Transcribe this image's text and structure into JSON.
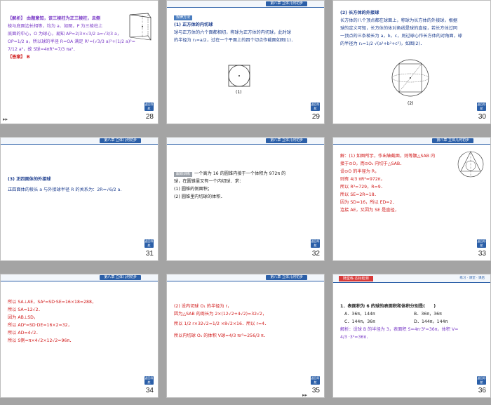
{
  "header_tab": "第八章 立体几何初步",
  "back_label": "返回导航",
  "slides": [
    {
      "page": "28",
      "lines": [
        "【解析】 由题意知，该三棱柱为正三棱柱，且侧",
        "棱与底面边长相等，均为 a．如图，P 为三棱柱上",
        "底面的中心，O 为球心，易知 AP=2/3×√3/2 a=√3/3 a，",
        "OP=1/2 a，所以球的半径 R=OA 满足 R²=(√3/3 a)²+(1/2 a)²=",
        "7/12 a²，故 S球=4πR²=7/3 πa²．",
        "【答案】 B"
      ]
    },
    {
      "page": "29",
      "section": "规律方法",
      "lines": [
        "(1) 正方体的内切球",
        "球与正方体的六个面都相切，称球为正方体的内切球，此时球",
        "的半径为 r₁=a/2，过在一个平面上的四个切点作截面如图(1)．"
      ],
      "fig_label": "(1)"
    },
    {
      "page": "30",
      "lines": [
        "(2) 长方体的外接球",
        "长方体的八个顶点都在球面上，称球为长方体的外接球，根据",
        "球的定义可知，长方体的体对角线是球的直径，若长方体过同",
        "一顶点的三条棱长为 a，b，c，则过球心作长方体的对角面，球",
        "的半径为 r₂=1/2 √(a²+b²+c²)，如图(2)．"
      ],
      "fig_label": "(2)"
    },
    {
      "page": "31",
      "lines": [
        "(3) 正四面体的外接球",
        "正四面体的棱长 a 与外接球半径 R 的关系为：2R=√6/2 a."
      ]
    },
    {
      "page": "32",
      "badge": "跟踪训练",
      "lines": [
        "一个高为 16 的圆锥内接于一个体积为 972π 的",
        "球，在圆锥里又有一个内切球．求：",
        "(1) 圆锥的侧面积；",
        "(2) 圆锥里内切球的体积．"
      ]
    },
    {
      "page": "33",
      "lines": [
        "解：(1) 如图所示，作出轴截面，则等腰△SAB 内",
        "接于⊙O，而⊙O₁ 内切于△SAB．",
        "设⊙O 的半径为 R，",
        "则有 4/3 πR³=972π，",
        "所以 R³=729，R=9．",
        "所以 SE=2R=18．",
        "因为 SD=16，所以 ED=2．",
        "连接 AE，又因为 SE 是直径，"
      ]
    },
    {
      "page": "34",
      "lines": [
        "所以 SA⊥AE，SA²=SD·SE=16×18=288，",
        "所以 SA=12√2．",
        "因为 AB⊥SD，",
        "所以 AD²=SD·DE=16×2=32，",
        "所以 AD=4√2．",
        "所以 S侧=π×4√2×12√2=96π．"
      ]
    },
    {
      "page": "35",
      "lines": [
        "(2) 设内切球 O₁ 的半径为 r，",
        "因为△SAB 的周长为 2×(12√2+4√2)=32√2，",
        "所以 1/2 r×32√2=1/2 ×8√2×16．所以 r=4．",
        "所以内切球 O₁ 的体积 V球=4/3 πr³=256/3 π．"
      ]
    },
    {
      "page": "36",
      "banner": "随堂练·达标检测",
      "banner_right": "练习 · 课堂 · 课后",
      "question": "1．表面积为 6 的球的表面积和体积分别是(　　)",
      "options": [
        "A．36π，144π",
        "B．36π，36π",
        "C．144π，36π",
        "D．144π，144π"
      ],
      "answer_lines": [
        "解析：设球 B 的半径为 3，表面积 S=4π·3²=36π，体积 V=",
        "4/3 ·3³=36π．"
      ]
    }
  ]
}
